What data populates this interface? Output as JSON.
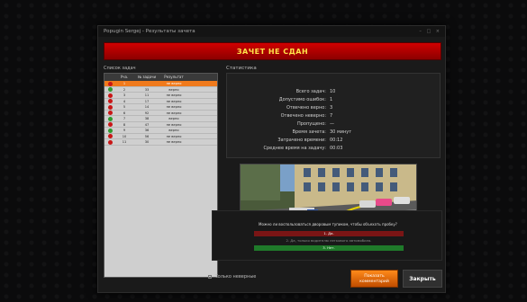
{
  "window": {
    "title": "Popugin Sergej - Результаты зачета",
    "controls": "– □ ×"
  },
  "banner": {
    "text": "ЗАЧЕТ НЕ СДАН",
    "color": "#c80000"
  },
  "task_list": {
    "caption": "Список задач",
    "headers": [
      "Уча.",
      "№ задачи",
      "Результат"
    ],
    "rows": [
      {
        "status": "red",
        "num": "1",
        "task": "",
        "result": "не верно",
        "selected": true
      },
      {
        "status": "green",
        "num": "2",
        "task": "33",
        "result": "верно"
      },
      {
        "status": "red",
        "num": "3",
        "task": "11",
        "result": "не верно"
      },
      {
        "status": "red",
        "num": "4",
        "task": "17",
        "result": "не верно"
      },
      {
        "status": "red",
        "num": "5",
        "task": "14",
        "result": "не верно"
      },
      {
        "status": "red",
        "num": "6",
        "task": "92",
        "result": "не верно"
      },
      {
        "status": "green",
        "num": "7",
        "task": "38",
        "result": "верно"
      },
      {
        "status": "red",
        "num": "8",
        "task": "47",
        "result": "не верно"
      },
      {
        "status": "green",
        "num": "9",
        "task": "36",
        "result": "верно"
      },
      {
        "status": "red",
        "num": "10",
        "task": "56",
        "result": "не верно"
      },
      {
        "status": "red",
        "num": "11",
        "task": "30",
        "result": "не верно"
      }
    ]
  },
  "statistics": {
    "title": "Статистика",
    "rows": [
      {
        "label": "Всего задач:",
        "value": "10"
      },
      {
        "label": "Допустимо ошибок:",
        "value": "1"
      },
      {
        "label": "Отвечено верно:",
        "value": "3"
      },
      {
        "label": "Отвечено неверно:",
        "value": "7"
      },
      {
        "label": "Пропущено:",
        "value": "—"
      },
      {
        "label": "Время зачета:",
        "value": "30 минут"
      },
      {
        "label": "Затрачено времени:",
        "value": "00:12"
      },
      {
        "label": "Среднее время на задачу:",
        "value": "00:03"
      }
    ]
  },
  "question": {
    "text": "Можно ли воспользоваться дворовым тупиком, чтобы объехать пробку?",
    "answers": [
      {
        "text": "1. Да.",
        "style": "red"
      },
      {
        "text": "2. Да, только водителю легкового автомобиля.",
        "style": "plain"
      },
      {
        "text": "3. Нет.",
        "style": "green"
      }
    ]
  },
  "footer": {
    "only_wrong_label": "Только неверные",
    "comment_button": "Показать комментарий",
    "close_button": "Закрыть"
  },
  "colors": {
    "accent": "#f07a1c",
    "danger": "#c80000",
    "success": "#1f7a2a"
  }
}
